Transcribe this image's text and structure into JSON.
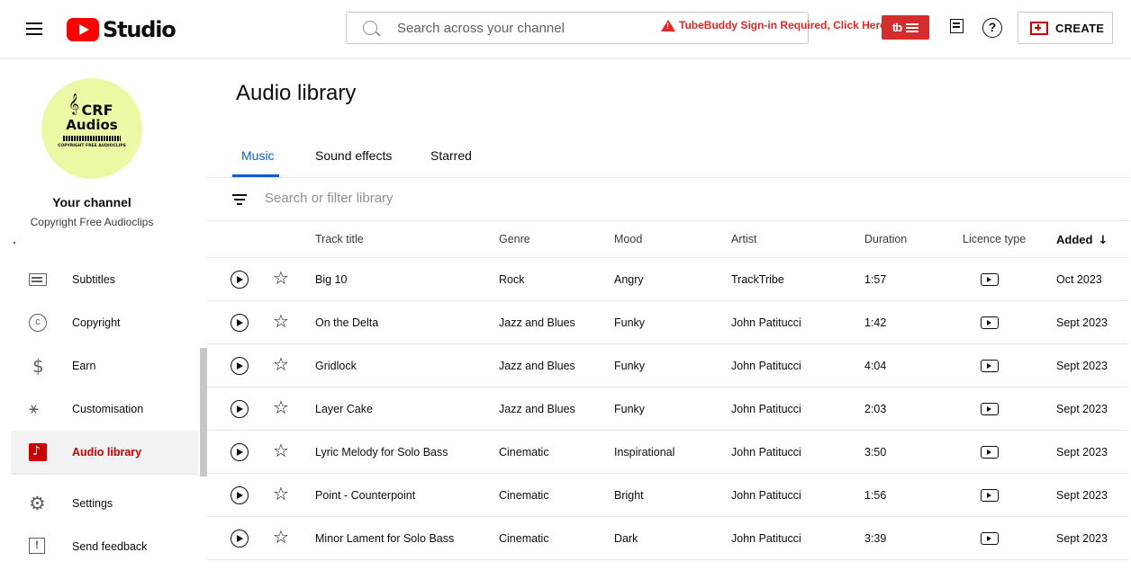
{
  "header": {
    "logo_text": "Studio",
    "search_placeholder": "Search across your channel",
    "tubebuddy_warning": "TubeBuddy Sign-in Required, Click Here",
    "tubebuddy_logo": "tb",
    "create_label": "CREATE"
  },
  "channel": {
    "avatar_line1": "CRF",
    "avatar_line2": "Audios",
    "avatar_sub": "COPYRIGHT FREE AUDIOCLIPS",
    "avatar_clef": "𝄞",
    "title": "Your channel",
    "name": "Copyright Free Audioclips"
  },
  "sidebar": {
    "items": [
      {
        "label": "Subtitles",
        "icon": "subtitles-icon"
      },
      {
        "label": "Copyright",
        "icon": "copyright-icon",
        "glyph": "c"
      },
      {
        "label": "Earn",
        "icon": "earn-icon",
        "glyph": "$"
      },
      {
        "label": "Customisation",
        "icon": "customisation-icon",
        "glyph": "⚹"
      },
      {
        "label": "Audio library",
        "icon": "audio-library-icon",
        "active": true
      },
      {
        "label": "Settings",
        "icon": "settings-icon",
        "glyph": "⚙"
      },
      {
        "label": "Send feedback",
        "icon": "feedback-icon",
        "glyph": "!"
      }
    ]
  },
  "main": {
    "title": "Audio library",
    "tabs": [
      {
        "label": "Music",
        "active": true
      },
      {
        "label": "Sound effects"
      },
      {
        "label": "Starred"
      }
    ],
    "filter_placeholder": "Search or filter library",
    "columns": {
      "title": "Track title",
      "genre": "Genre",
      "mood": "Mood",
      "artist": "Artist",
      "duration": "Duration",
      "licence": "Licence type",
      "added": "Added",
      "sort_arrow": "↓"
    },
    "rows": [
      {
        "title": "Big 10",
        "genre": "Rock",
        "mood": "Angry",
        "artist": "TrackTribe",
        "duration": "1:57",
        "added": "Oct 2023"
      },
      {
        "title": "On the Delta",
        "genre": "Jazz and Blues",
        "mood": "Funky",
        "artist": "John Patitucci",
        "duration": "1:42",
        "added": "Sept 2023"
      },
      {
        "title": "Gridlock",
        "genre": "Jazz and Blues",
        "mood": "Funky",
        "artist": "John Patitucci",
        "duration": "4:04",
        "added": "Sept 2023"
      },
      {
        "title": "Layer Cake",
        "genre": "Jazz and Blues",
        "mood": "Funky",
        "artist": "John Patitucci",
        "duration": "2:03",
        "added": "Sept 2023"
      },
      {
        "title": "Lyric Melody for Solo Bass",
        "genre": "Cinematic",
        "mood": "Inspirational",
        "artist": "John Patitucci",
        "duration": "3:50",
        "added": "Sept 2023"
      },
      {
        "title": "Point - Counterpoint",
        "genre": "Cinematic",
        "mood": "Bright",
        "artist": "John Patitucci",
        "duration": "1:56",
        "added": "Sept 2023"
      },
      {
        "title": "Minor Lament for Solo Bass",
        "genre": "Cinematic",
        "mood": "Dark",
        "artist": "John Patitucci",
        "duration": "3:39",
        "added": "Sept 2023"
      }
    ]
  },
  "colors": {
    "brand_red": "#ff0000",
    "active_red": "#cc0000",
    "tab_blue": "#065fd4",
    "tubebuddy_red": "#d42d2d"
  }
}
